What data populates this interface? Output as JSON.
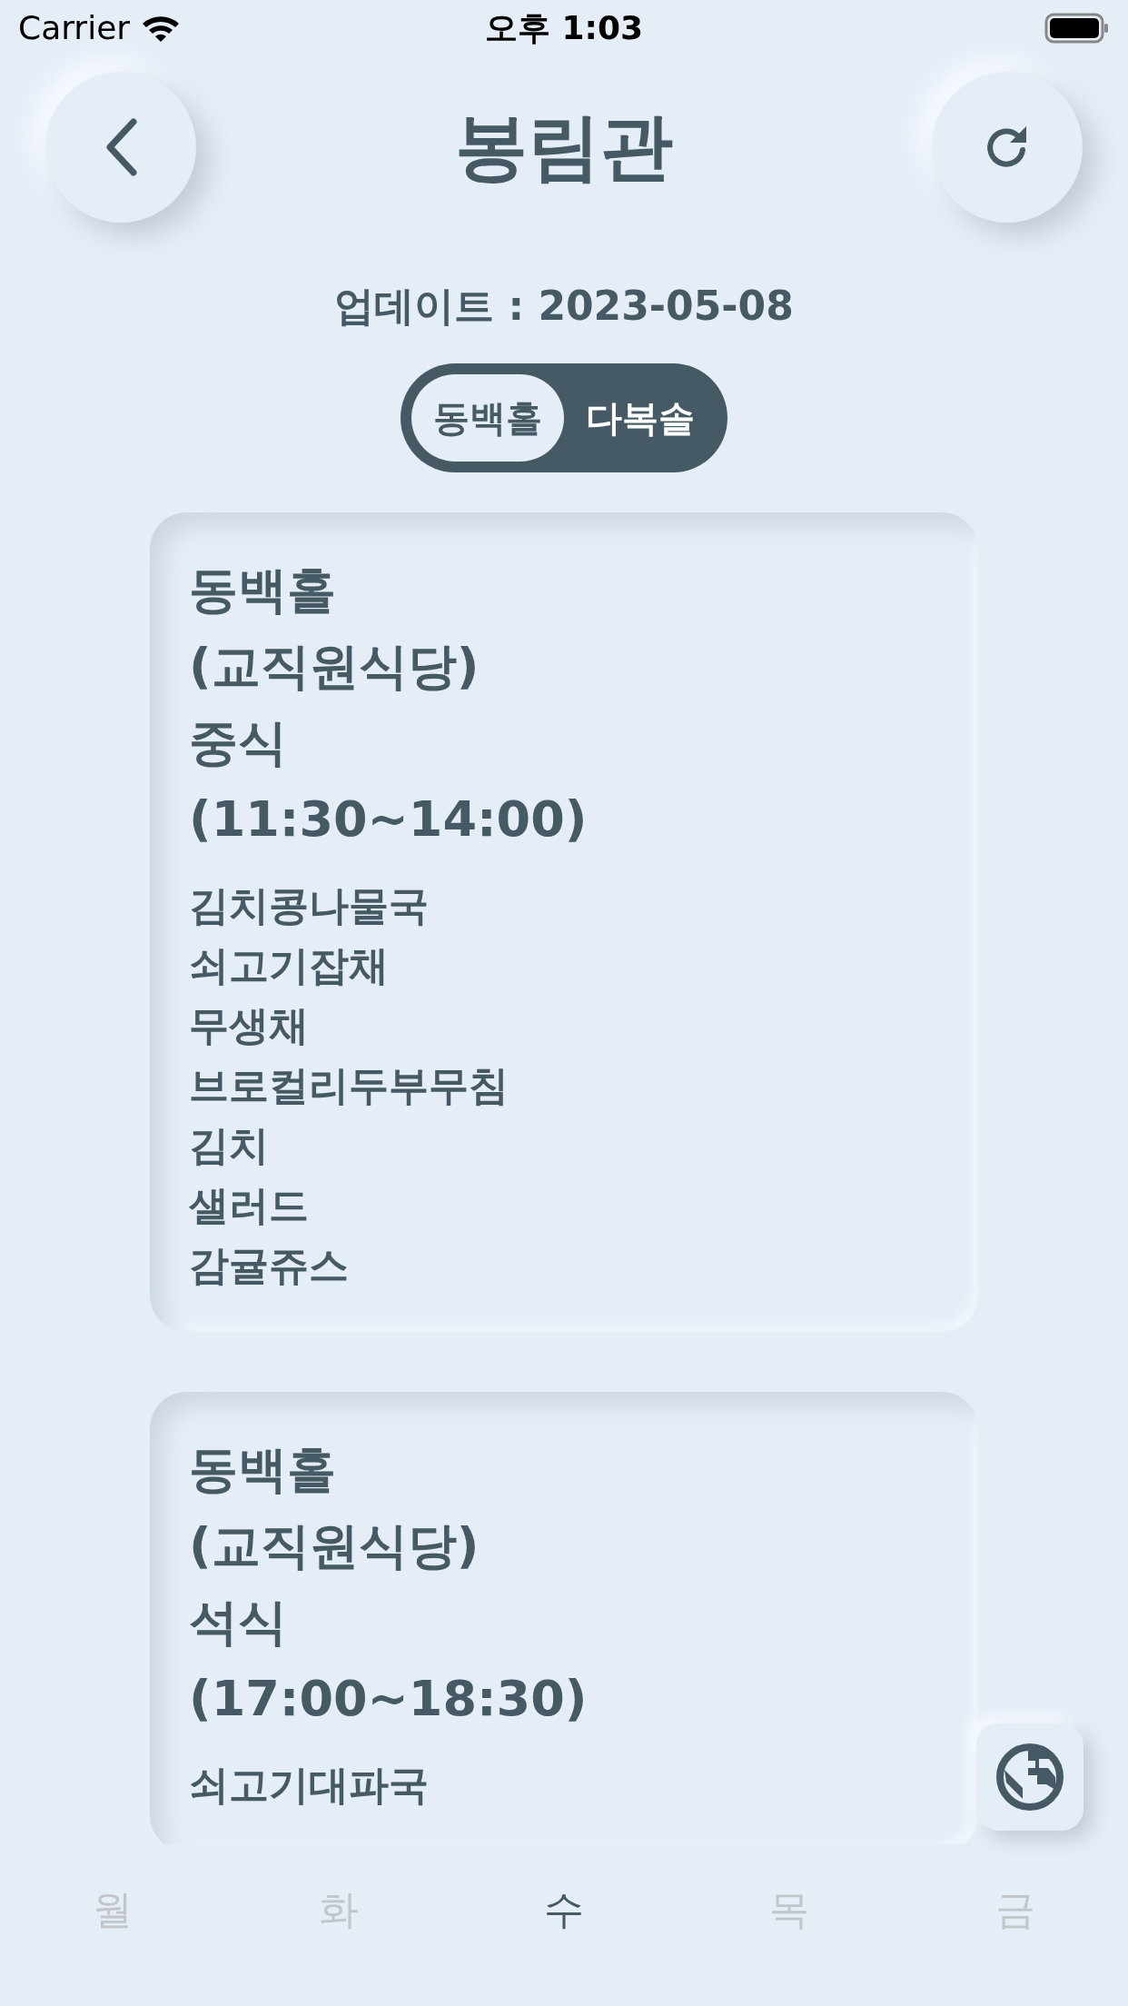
{
  "status_bar": {
    "carrier": "Carrier",
    "time": "오후 1:03"
  },
  "header": {
    "title": "봉림관"
  },
  "updated": "업데이트 : 2023-05-08",
  "segments": [
    {
      "label": "동백홀",
      "selected": true
    },
    {
      "label": "다복솔",
      "selected": false
    }
  ],
  "meals": [
    {
      "title_lines": [
        "동백홀",
        "(교직원식당)",
        "중식",
        "(11:30~14:00)"
      ],
      "items": [
        "김치콩나물국",
        "쇠고기잡채",
        "무생채",
        "브로컬리두부무침",
        "김치",
        "샐러드",
        "감귤쥬스"
      ]
    },
    {
      "title_lines": [
        "동백홀",
        "(교직원식당)",
        "석식",
        "(17:00~18:30)"
      ],
      "items": [
        "쇠고기대파국"
      ]
    }
  ],
  "days": [
    {
      "label": "월",
      "selected": false
    },
    {
      "label": "화",
      "selected": false
    },
    {
      "label": "수",
      "selected": true
    },
    {
      "label": "목",
      "selected": false
    },
    {
      "label": "금",
      "selected": false
    }
  ]
}
